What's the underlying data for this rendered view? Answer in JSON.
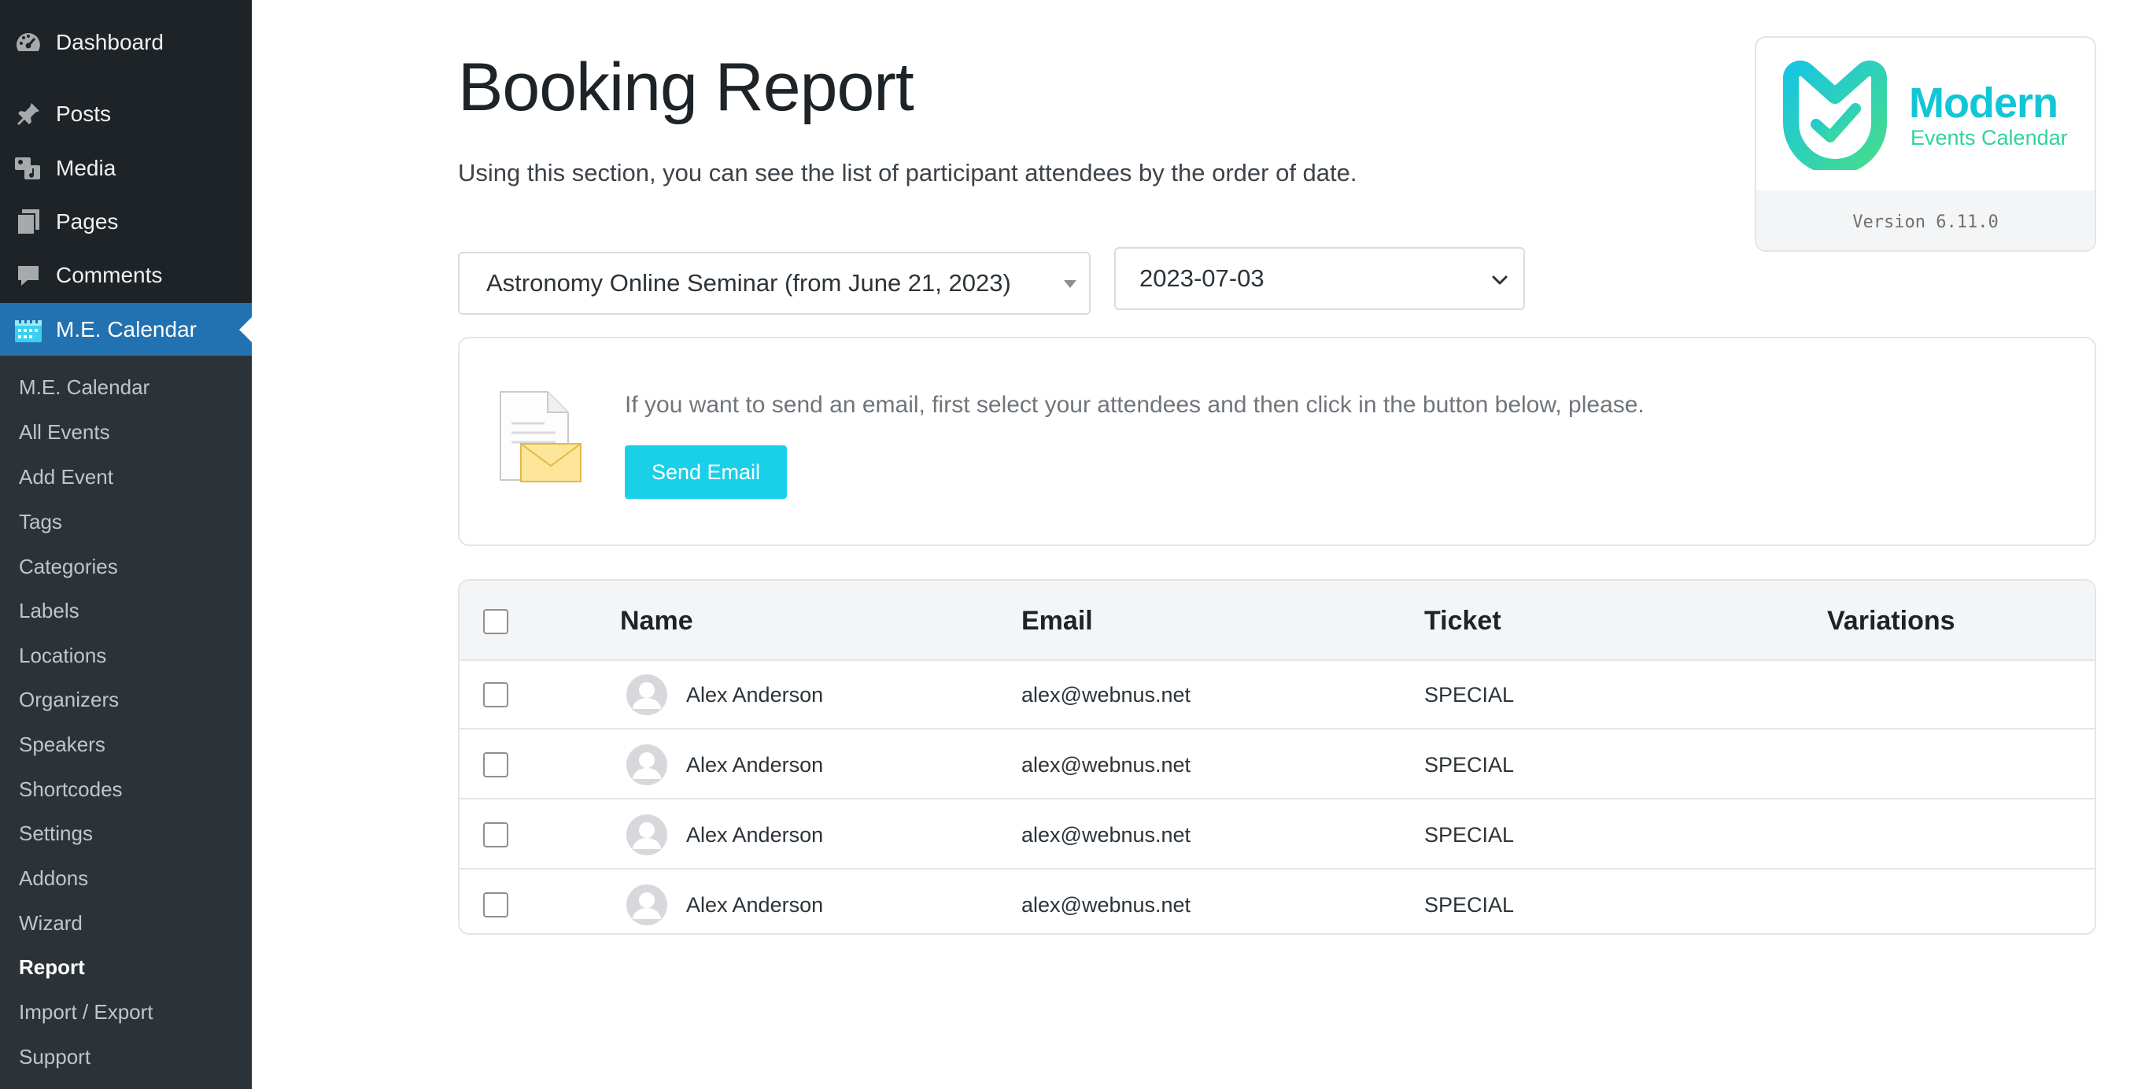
{
  "sidebar": {
    "menu": [
      {
        "label": "Dashboard",
        "icon": "dashboard-icon"
      },
      {
        "label": "Posts",
        "icon": "pin-icon"
      },
      {
        "label": "Media",
        "icon": "media-icon"
      },
      {
        "label": "Pages",
        "icon": "pages-icon"
      },
      {
        "label": "Comments",
        "icon": "comment-icon"
      },
      {
        "label": "M.E. Calendar",
        "icon": "calendar-icon",
        "active": true
      }
    ],
    "submenu": [
      "M.E. Calendar",
      "All Events",
      "Add Event",
      "Tags",
      "Categories",
      "Labels",
      "Locations",
      "Organizers",
      "Speakers",
      "Shortcodes",
      "Settings",
      "Addons",
      "Wizard",
      "Report",
      "Import / Export",
      "Support"
    ],
    "current_submenu": "Report"
  },
  "header": {
    "title": "Booking Report",
    "description": "Using this section, you can see the list of participant attendees by the order of date."
  },
  "logo": {
    "word1": "Modern",
    "word2": "Events Calendar",
    "version": "Version 6.11.0"
  },
  "filters": {
    "event_select": "Astronomy Online Seminar (from June 21, 2023)",
    "date_select": "2023-07-03"
  },
  "email_box": {
    "message": "If you want to send an email, first select your attendees and then click in the button below, please.",
    "button_label": "Send Email"
  },
  "table": {
    "headers": {
      "name": "Name",
      "email": "Email",
      "ticket": "Ticket",
      "variations": "Variations"
    },
    "rows": [
      {
        "name": "Alex Anderson",
        "email": "alex@webnus.net",
        "ticket": "SPECIAL",
        "variations": ""
      },
      {
        "name": "Alex Anderson",
        "email": "alex@webnus.net",
        "ticket": "SPECIAL",
        "variations": ""
      },
      {
        "name": "Alex Anderson",
        "email": "alex@webnus.net",
        "ticket": "SPECIAL",
        "variations": ""
      },
      {
        "name": "Alex Anderson",
        "email": "alex@webnus.net",
        "ticket": "SPECIAL",
        "variations": ""
      }
    ]
  },
  "colors": {
    "sidebar_bg": "#1d2327",
    "submenu_bg": "#2c3338",
    "active_blue": "#2271b1",
    "button_cyan": "#19d0e8"
  }
}
